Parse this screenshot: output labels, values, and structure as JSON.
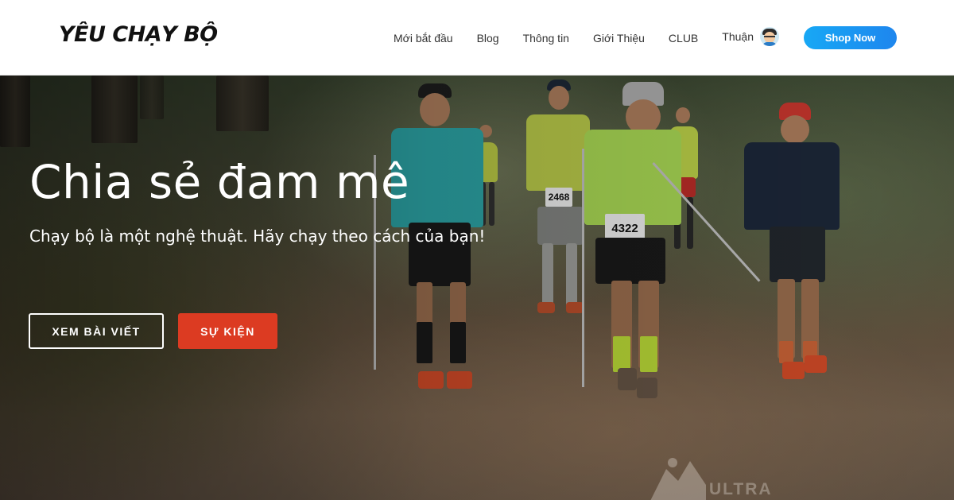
{
  "header": {
    "logo": "YÊU CHẠY BỘ",
    "nav": [
      {
        "label": "Mới bắt đầu"
      },
      {
        "label": "Blog"
      },
      {
        "label": "Thông tin"
      },
      {
        "label": "Giới Thiệu"
      },
      {
        "label": "CLUB"
      }
    ],
    "user": {
      "name": "Thuận",
      "avatar_icon": "user-avatar"
    },
    "shop_button": "Shop Now"
  },
  "hero": {
    "title": "Chia sẻ đam mê",
    "subtitle": "Chạy bộ là một nghệ thuật. Hãy chạy theo cách của bạn!",
    "buttons": {
      "posts": "XEM BÀI VIẾT",
      "events": "SỰ KIỆN"
    },
    "bibs": [
      "2468",
      "4322"
    ],
    "watermark": "ULTRA"
  },
  "colors": {
    "shop_gradient_start": "#17a8f5",
    "shop_gradient_end": "#1e86ee",
    "events_button": "#dc3b22"
  }
}
